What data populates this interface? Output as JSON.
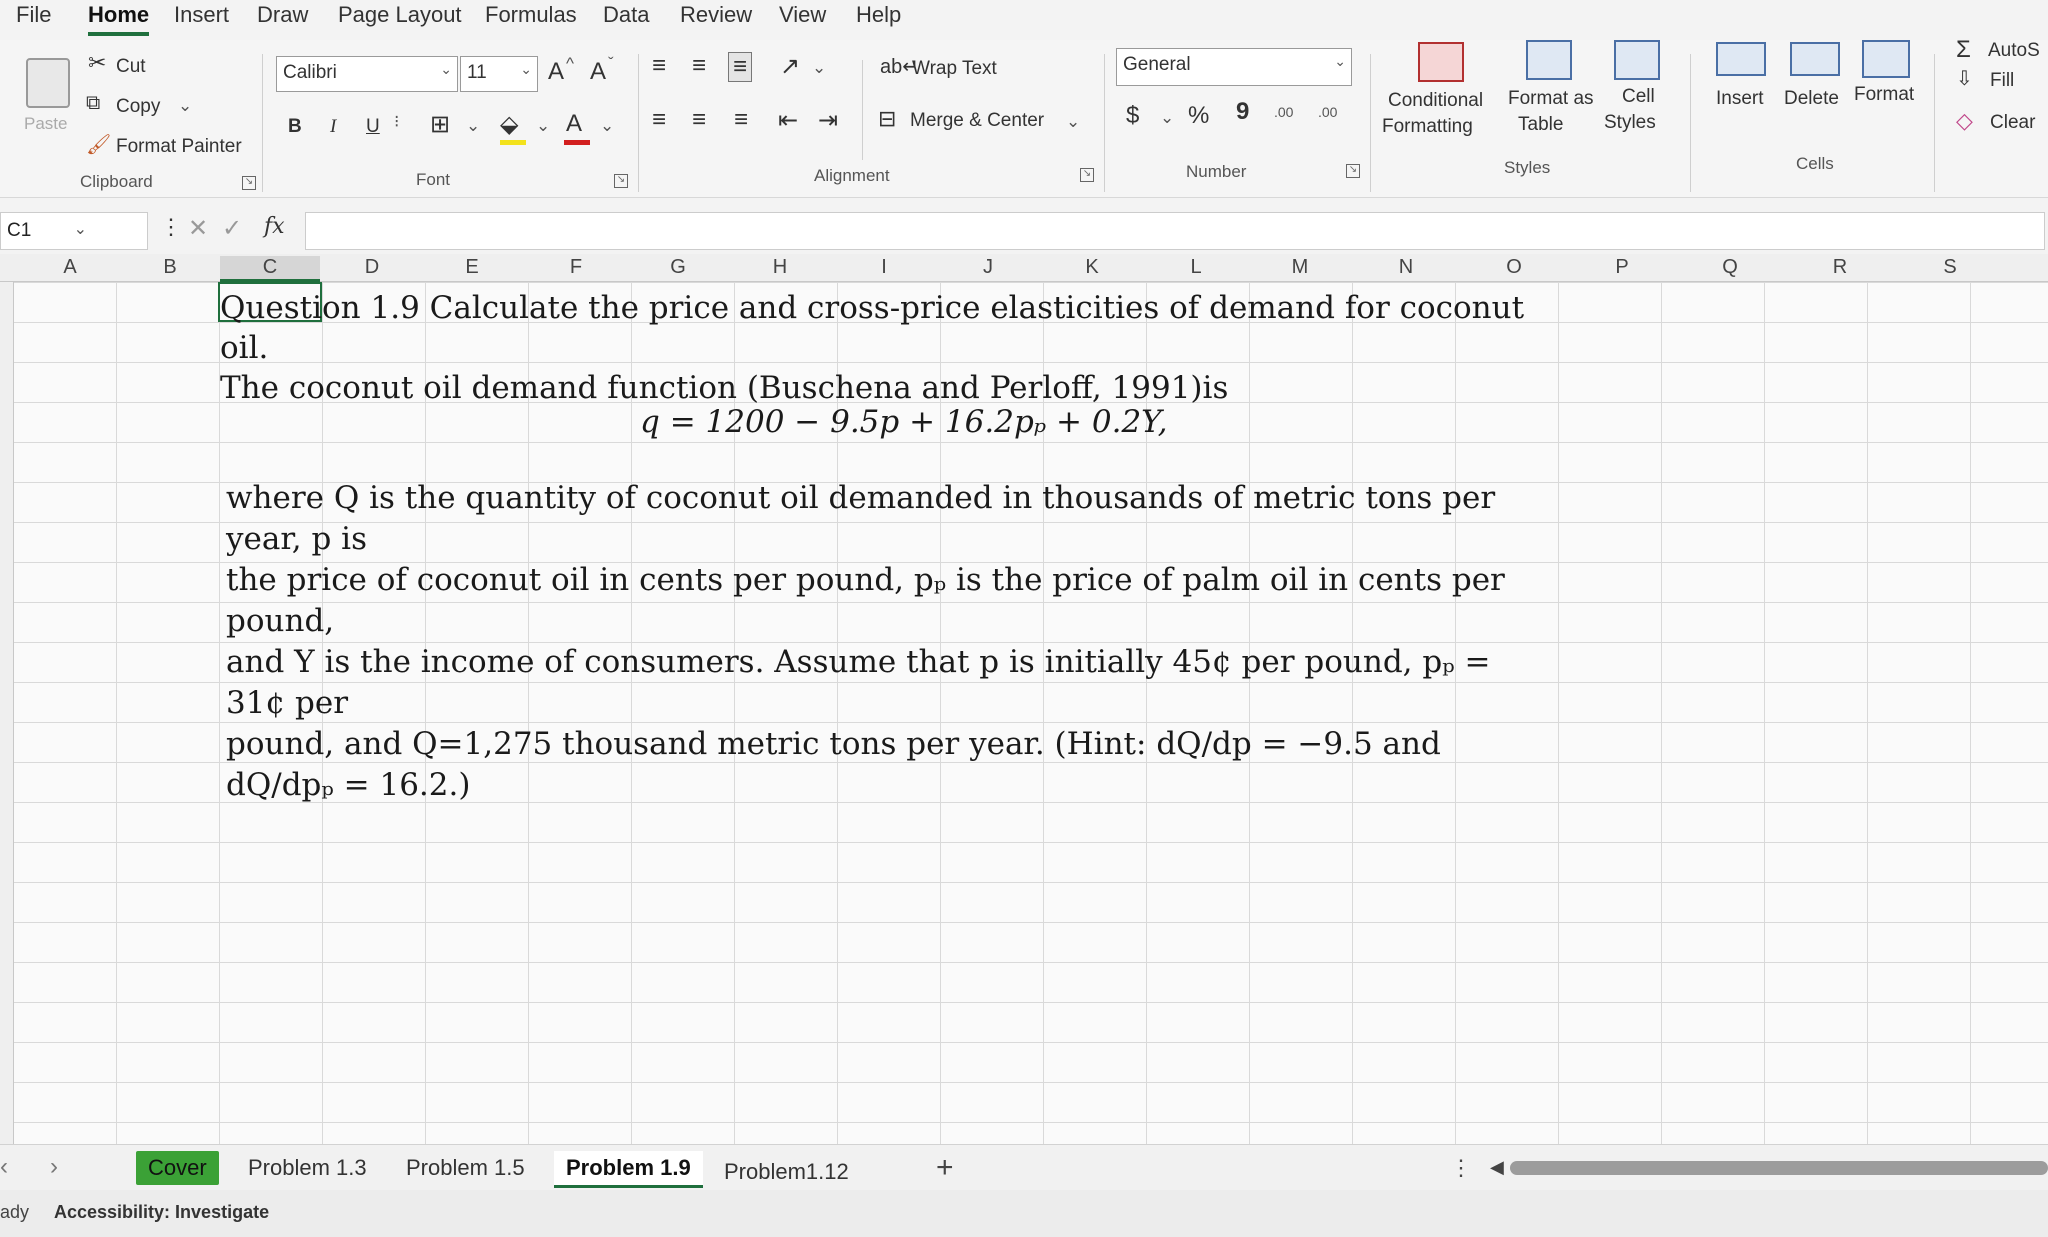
{
  "menu": [
    "File",
    "Home",
    "Insert",
    "Draw",
    "Page Layout",
    "Formulas",
    "Data",
    "Review",
    "View",
    "Help"
  ],
  "active_menu": "Home",
  "clipboard": {
    "paste": "Paste",
    "cut": "Cut",
    "copy": "Copy",
    "format_painter": "Format Painter",
    "label": "Clipboard"
  },
  "font": {
    "name": "Calibri",
    "size": "11",
    "grow": "A",
    "shrink": "A",
    "bold": "B",
    "italic": "I",
    "underline": "U",
    "color_letter": "A",
    "label": "Font"
  },
  "alignment": {
    "wrap_text": "Wrap Text",
    "merge_center": "Merge & Center",
    "label": "Alignment"
  },
  "number": {
    "format": "General",
    "currency": "$",
    "percent": "%",
    "comma": "9",
    "inc_decimal": ".00",
    "dec_decimal": ".00",
    "label": "Number"
  },
  "styles": {
    "conditional_1": "Conditional",
    "conditional_2": "Formatting",
    "format_table_1": "Format as",
    "format_table_2": "Table",
    "cell_styles_1": "Cell",
    "cell_styles_2": "Styles",
    "label": "Styles"
  },
  "cells": {
    "insert": "Insert",
    "delete": "Delete",
    "format": "Format",
    "label": "Cells"
  },
  "editing": {
    "autosum": "AutoS",
    "fill": "Fill",
    "clear": "Clear"
  },
  "formula_bar": {
    "name_box": "C1",
    "fx": "fx",
    "value": ""
  },
  "columns": [
    "A",
    "B",
    "C",
    "D",
    "E",
    "F",
    "G",
    "H",
    "I",
    "J",
    "K",
    "L",
    "M",
    "N",
    "O",
    "P",
    "Q",
    "R",
    "S"
  ],
  "selected_column": "C",
  "content": {
    "question_line1": "Question 1.9 Calculate the price and cross-price elasticities of demand for coconut oil.",
    "question_line2": "The coconut oil demand function (Buschena and Perloff, 1991)is",
    "equation": "q = 1200 − 9.5p + 16.2pₚ + 0.2Y,",
    "desc_line1": "where Q is the quantity of coconut oil demanded in thousands of metric tons per year, p is",
    "desc_line2": "the price of coconut oil in cents per pound, pₚ is the price of palm oil in cents per pound,",
    "desc_line3": "and Y is the income of consumers. Assume that p is initially 45¢ per pound, pₚ = 31¢ per",
    "desc_line4": "pound, and Q=1,275 thousand metric tons per year. (Hint: dQ/dp = −9.5 and",
    "desc_line5": "dQ/dpₚ = 16.2.)"
  },
  "sheets": [
    "Cover",
    "Problem 1.3",
    "Problem 1.5",
    "Problem 1.9",
    "Problem1.12"
  ],
  "active_sheet": "Problem 1.9",
  "add_sheet": "+",
  "status": {
    "ready": "ady",
    "accessibility": "Accessibility: Investigate"
  },
  "colors": {
    "accent": "#1f6f3d",
    "cover_tab": "#3ba136"
  }
}
